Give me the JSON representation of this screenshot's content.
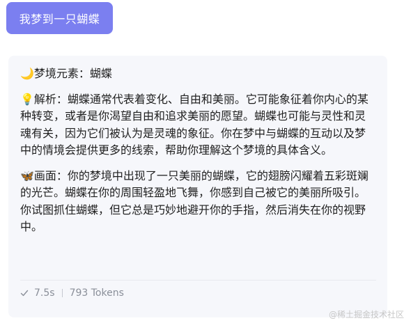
{
  "prompt": {
    "label": "我梦到一只蝴蝶"
  },
  "reply": {
    "element_line": "🌙梦境元素：蝴蝶",
    "analysis": "💡解析：蝴蝶通常代表着变化、自由和美丽。它可能象征着你内心的某种转变，或者是你渴望自由和追求美丽的愿望。蝴蝶也可能与灵性和灵魂有关，因为它们被认为是灵魂的象征。你在梦中与蝴蝶的互动以及梦中的情境会提供更多的线索，帮助你理解这个梦境的具体含义。",
    "scene": "🦋画面：你的梦境中出现了一只美丽的蝴蝶，它的翅膀闪耀着五彩斑斓的光芒。蝴蝶在你的周围轻盈地飞舞，你感到自己被它的美丽所吸引。你试图抓住蝴蝶，但它总是巧妙地避开你的手指，然后消失在你的视野中。"
  },
  "footer": {
    "time": "7.5s",
    "tokens": "793 Tokens",
    "check_icon": "check-icon"
  },
  "watermark": "@稀土掘金技术社区",
  "colors": {
    "accent": "#7b7ff0",
    "card_bg": "#f6f7fb",
    "muted": "#8a8f99"
  }
}
